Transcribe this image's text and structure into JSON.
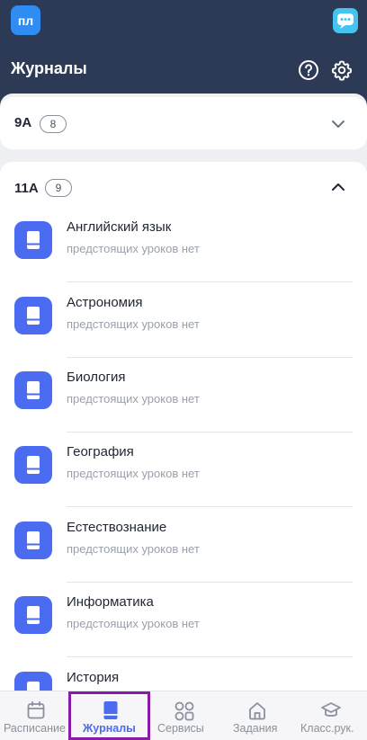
{
  "header": {
    "avatar_initials": "пл",
    "title": "Журналы",
    "icons": [
      "chat-icon",
      "help-icon",
      "gear-icon"
    ]
  },
  "classes": [
    {
      "name": "9А",
      "count": "8",
      "expanded": false
    },
    {
      "name": "11А",
      "count": "9",
      "expanded": true
    }
  ],
  "subjects": [
    {
      "name": "Английский язык",
      "status": "предстоящих уроков нет"
    },
    {
      "name": "Астрономия",
      "status": "предстоящих уроков нет"
    },
    {
      "name": "Биология",
      "status": "предстоящих уроков нет"
    },
    {
      "name": "География",
      "status": "предстоящих уроков нет"
    },
    {
      "name": "Естествознание",
      "status": "предстоящих уроков нет"
    },
    {
      "name": "Информатика",
      "status": "предстоящих уроков нет"
    },
    {
      "name": "История",
      "status": ""
    }
  ],
  "bottom_nav": [
    {
      "label": "Расписание",
      "icon": "calendar-icon",
      "active": false
    },
    {
      "label": "Журналы",
      "icon": "journal-icon",
      "active": true
    },
    {
      "label": "Сервисы",
      "icon": "grid-icon",
      "active": false
    },
    {
      "label": "Задания",
      "icon": "home-icon",
      "active": false
    },
    {
      "label": "Класс.рук.",
      "icon": "graduation-cap-icon",
      "active": false
    }
  ],
  "colors": {
    "header_bg": "#2d3a56",
    "accent": "#4b6bf0",
    "highlight_border": "#8a1ba8"
  }
}
